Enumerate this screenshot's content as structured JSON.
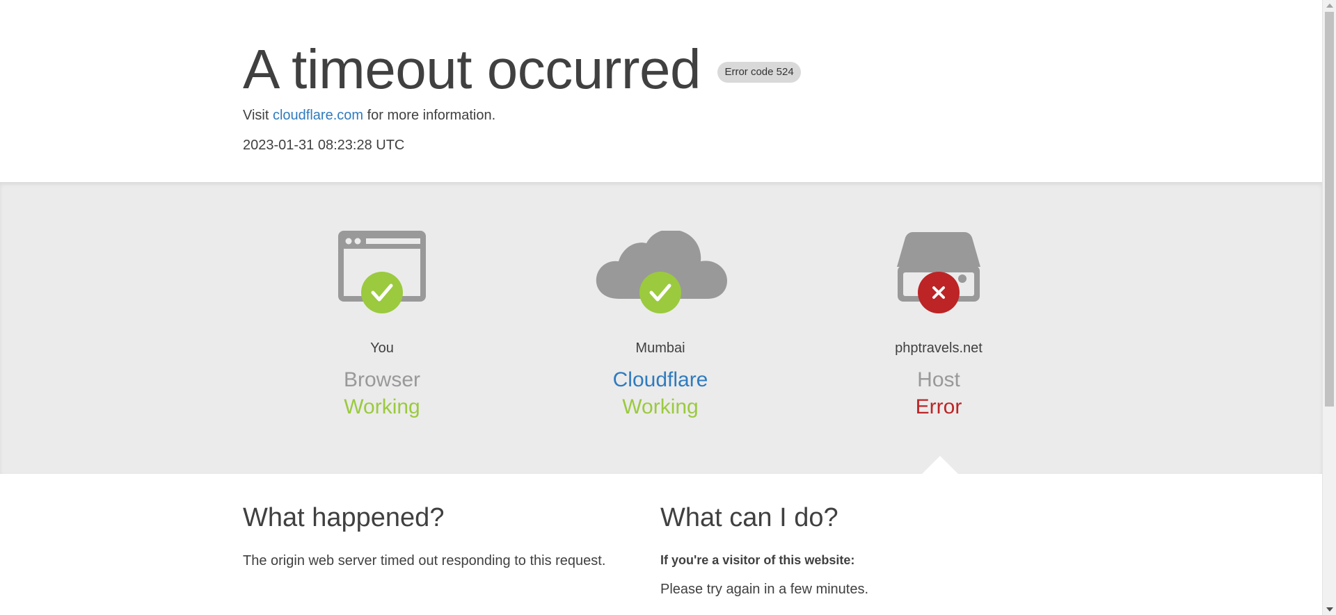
{
  "header": {
    "title": "A timeout occurred",
    "badge": "Error code 524",
    "visit_prefix": "Visit",
    "visit_link": "cloudflare.com",
    "visit_suffix": "for more information.",
    "timestamp": "2023-01-31 08:23:28 UTC"
  },
  "status": {
    "columns": [
      {
        "location": "You",
        "service": "Browser",
        "state": "Working",
        "icon": "browser-icon",
        "badge": "check-icon"
      },
      {
        "location": "Mumbai",
        "service": "Cloudflare",
        "state": "Working",
        "icon": "cloud-icon",
        "badge": "check-icon"
      },
      {
        "location": "phptravels.net",
        "service": "Host",
        "state": "Error",
        "icon": "server-icon",
        "badge": "x-icon"
      }
    ]
  },
  "colors": {
    "ok": "#9bca3e",
    "error": "#bd2426",
    "link": "#2f7bbf",
    "icon_gray": "#999999",
    "band": "#ebebeb"
  },
  "what_happened": {
    "heading": "What happened?",
    "text": "The origin web server timed out responding to this request."
  },
  "what_can_i_do": {
    "heading": "What can I do?",
    "subheading": "If you're a visitor of this website:",
    "text": "Please try again in a few minutes."
  }
}
